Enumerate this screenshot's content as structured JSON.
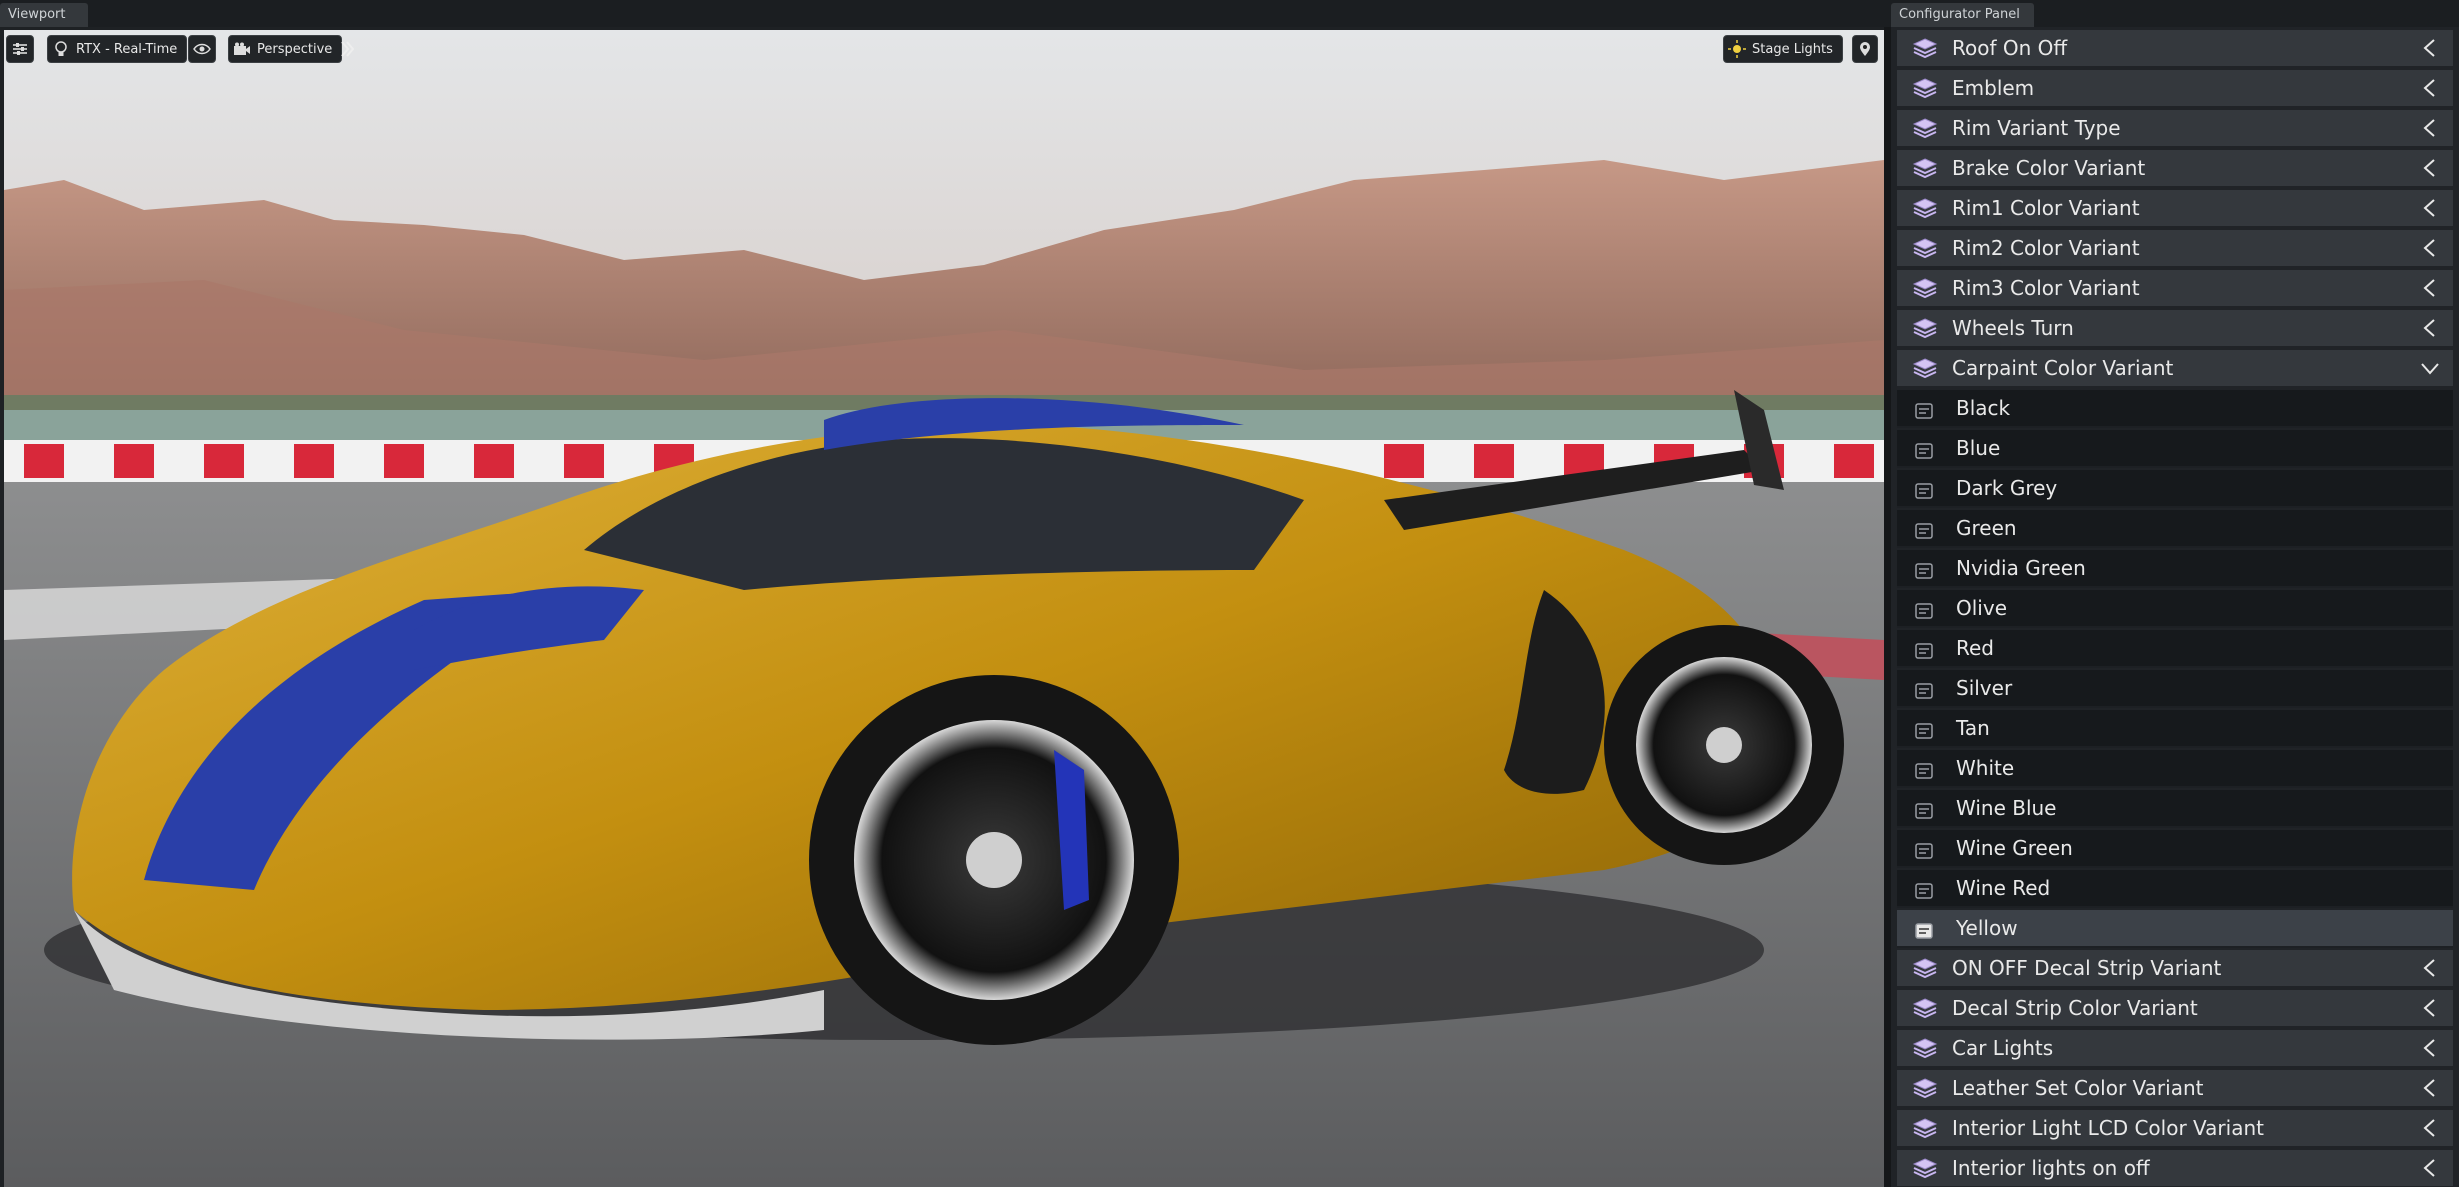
{
  "tabs": {
    "viewport": "Viewport",
    "configurator": "Configurator Panel"
  },
  "viewport_toolbar": {
    "renderer": "RTX - Real-Time",
    "camera": "Perspective",
    "lighting": "Stage Lights"
  },
  "panel": {
    "groups_before": [
      {
        "label": "Roof On Off"
      },
      {
        "label": "Emblem"
      },
      {
        "label": "Rim Variant Type"
      },
      {
        "label": "Brake Color Variant"
      },
      {
        "label": "Rim1 Color Variant"
      },
      {
        "label": "Rim2 Color Variant"
      },
      {
        "label": "Rim3 Color Variant"
      },
      {
        "label": "Wheels Turn"
      }
    ],
    "expanded_group": {
      "label": "Carpaint Color Variant",
      "options": [
        {
          "label": "Black"
        },
        {
          "label": "Blue"
        },
        {
          "label": "Dark Grey"
        },
        {
          "label": "Green"
        },
        {
          "label": "Nvidia Green"
        },
        {
          "label": "Olive"
        },
        {
          "label": "Red"
        },
        {
          "label": "Silver"
        },
        {
          "label": "Tan"
        },
        {
          "label": "White"
        },
        {
          "label": "Wine Blue"
        },
        {
          "label": "Wine Green"
        },
        {
          "label": "Wine Red"
        },
        {
          "label": "Yellow"
        }
      ],
      "selected": "Yellow"
    },
    "groups_after": [
      {
        "label": "ON OFF Decal Strip Variant"
      },
      {
        "label": "Decal Strip Color Variant"
      },
      {
        "label": "Car Lights"
      },
      {
        "label": "Leather Set Color Variant"
      },
      {
        "label": "Interior Light LCD Color Variant"
      },
      {
        "label": "Interior lights on off"
      }
    ]
  },
  "colors": {
    "car_paint": "#c99a12",
    "stripe": "#2a3fa8",
    "group_row": "#34383d",
    "option_row": "#16191c",
    "selected_row": "#3c4148",
    "layer_icon": "#c8b6f0"
  }
}
